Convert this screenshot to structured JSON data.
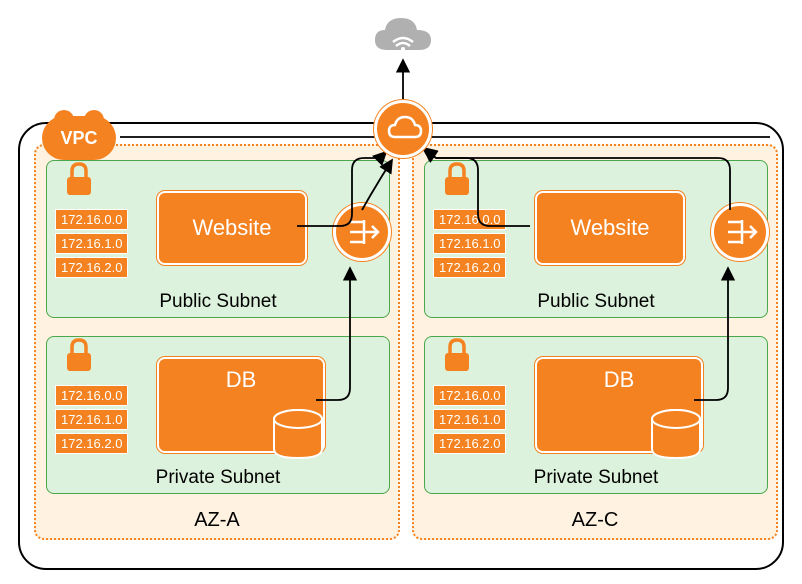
{
  "vpc": {
    "label": "VPC"
  },
  "az_a": {
    "label": "AZ-A",
    "public": {
      "label": "Public Subnet",
      "cidrs": [
        "172.16.0.0",
        "172.16.1.0",
        "172.16.2.0"
      ],
      "service": "Website"
    },
    "private": {
      "label": "Private Subnet",
      "cidrs": [
        "172.16.0.0",
        "172.16.1.0",
        "172.16.2.0"
      ],
      "service": "DB"
    }
  },
  "az_c": {
    "label": "AZ-C",
    "public": {
      "label": "Public Subnet",
      "cidrs": [
        "172.16.0.0",
        "172.16.1.0",
        "172.16.2.0"
      ],
      "service": "Website"
    },
    "private": {
      "label": "Private Subnet",
      "cidrs": [
        "172.16.0.0",
        "172.16.1.0",
        "172.16.2.0"
      ],
      "service": "DB"
    }
  },
  "icons": {
    "internet_cloud": "cloud-wifi",
    "internet_gateway": "igw",
    "nat_gateway": "nat",
    "lock": "padlock",
    "database": "db-cylinder"
  }
}
